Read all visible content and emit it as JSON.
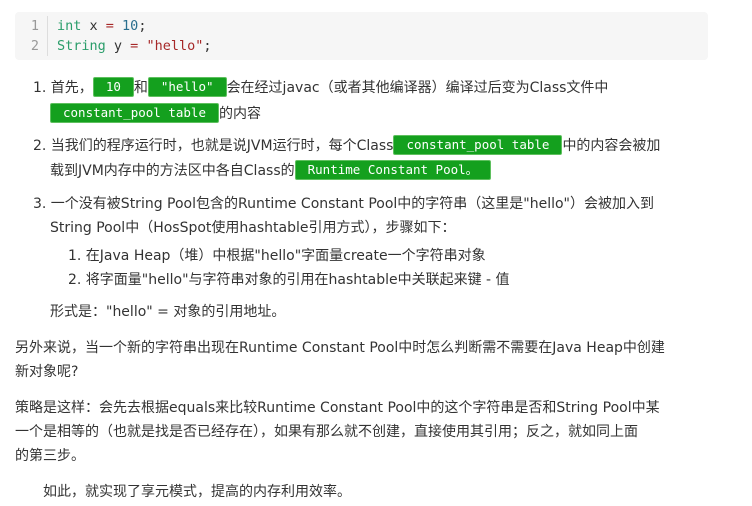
{
  "code": {
    "line_numbers": [
      "1",
      "2"
    ],
    "line1": {
      "kw": "int",
      "rest": " x  ",
      "op": "=",
      "val": " 10",
      "end": ";"
    },
    "line2": {
      "kw": "String",
      "rest": " y ",
      "op": "=",
      "val": " \"hello\"",
      "end": ";"
    }
  },
  "items": [
    {
      "p1": "1. 首先，",
      "c1": "10",
      "p2": "和",
      "c2": "\"hello\"",
      "p3": "会在经过javac（或者其他编译器）编译过后变为Class文件中",
      "c3": "constant_pool table",
      "p4": "的内容"
    },
    {
      "p1": "2. 当我们的程序运行时，也就是说JVM运行时，每个Class",
      "c1": "constant_pool table",
      "p2": "中的内容会被加",
      "p3": "载到JVM内存中的方法区中各自Class的",
      "c2": "Runtime Constant Pool。"
    },
    {
      "l1": "3. 一个没有被String Pool包含的Runtime Constant Pool中的字符串（这里是\"hello\"）会被加入到",
      "l2": "String Pool中（HosSpot使用hashtable引用方式），步骤如下：",
      "sub": [
        "1. 在Java Heap（堆）中根据\"hello\"字面量create一个字符串对象",
        "2. 将字面量\"hello\"与字符串对象的引用在hashtable中关联起来键 - 值"
      ],
      "form": "形式是：\"hello\" = 对象的引用地址。"
    }
  ],
  "para1": [
    "另外来说，当一个新的字符串出现在Runtime Constant Pool中时怎么判断需不需要在Java Heap中创建",
    "新对象呢?"
  ],
  "para2": [
    "策略是这样：会先去根据equals来比较Runtime Constant Pool中的这个字符串是否和String Pool中某",
    "一个是相等的（也就是找是否已经存在），如果有那么就不创建，直接使用其引用；反之，就如同上面",
    "的第三步。"
  ],
  "para3": "如此，就实现了享元模式，提高的内存利用效率。"
}
